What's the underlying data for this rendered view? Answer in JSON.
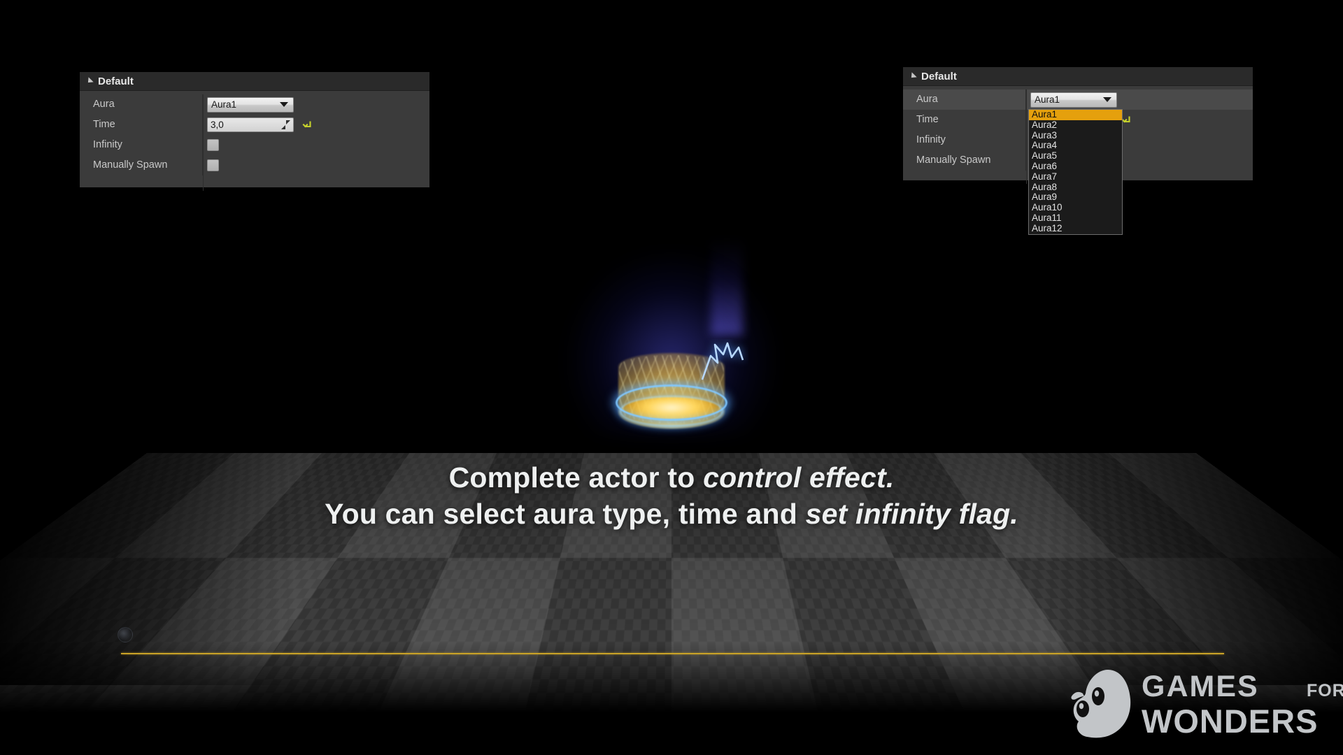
{
  "scene": {
    "caption_line1_a": "Complete actor to ",
    "caption_line1_b": "control effect.",
    "caption_line2_a": "You can select aura type, time and ",
    "caption_line2_b": "set infinity flag.",
    "effect_name": "aura-effect",
    "accent_gold": "#c9a227",
    "aura_color": "#ffd65c",
    "bolt_color": "#82c8ff"
  },
  "left_panel": {
    "header": "Default",
    "rows": [
      {
        "label": "Aura",
        "type": "combo",
        "value": "Aura1"
      },
      {
        "label": "Time",
        "type": "number",
        "value": "3,0",
        "has_reset": true
      },
      {
        "label": "Infinity",
        "type": "checkbox",
        "checked": false
      },
      {
        "label": "Manually Spawn",
        "type": "checkbox",
        "checked": false
      }
    ]
  },
  "right_panel": {
    "header": "Default",
    "rows": [
      {
        "label": "Aura",
        "type": "combo",
        "value": "Aura1",
        "highlighted": true
      },
      {
        "label": "Time",
        "type": "number",
        "value": "",
        "has_reset": true
      },
      {
        "label": "Infinity",
        "type": "checkbox",
        "checked": false
      },
      {
        "label": "Manually Spawn",
        "type": "checkbox",
        "checked": false
      }
    ],
    "dropdown": {
      "open": true,
      "selected": "Aura1",
      "options": [
        "Aura1",
        "Aura2",
        "Aura3",
        "Aura4",
        "Aura5",
        "Aura6",
        "Aura7",
        "Aura8",
        "Aura9",
        "Aura10",
        "Aura11",
        "Aura12"
      ]
    }
  },
  "logo": {
    "line1": "GAMES",
    "small": "FOR",
    "line2": "WONDERS",
    "mascot": "ghost-mascot",
    "color": "#c2c5c8"
  }
}
